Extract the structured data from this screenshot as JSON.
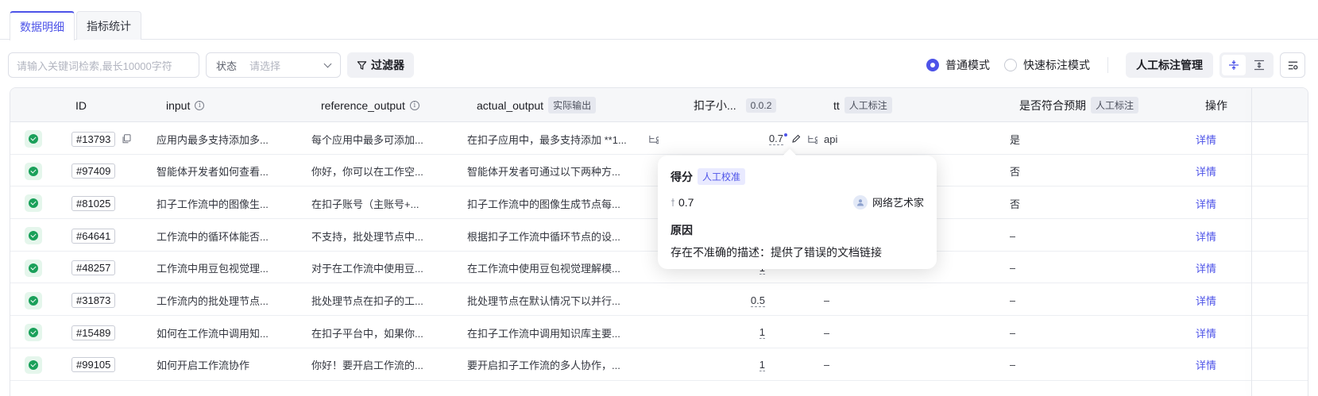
{
  "tabs": [
    {
      "label": "数据明细",
      "active": true
    },
    {
      "label": "指标统计",
      "active": false
    }
  ],
  "toolbar": {
    "search_placeholder": "请输入关键词检索,最长10000字符",
    "status_label": "状态",
    "status_placeholder": "请选择",
    "filter_label": "过滤器",
    "mode_normal": "普通模式",
    "mode_fast": "快速标注模式",
    "manage_label": "人工标注管理"
  },
  "columns": {
    "id": "ID",
    "input": "input",
    "reference_output": "reference_output",
    "actual_output": "actual_output",
    "actual_output_tag": "实际输出",
    "kouzi": "扣子小...",
    "kouzi_version": "0.0.2",
    "tt": "tt",
    "tt_tag": "人工标注",
    "expect": "是否符合预期",
    "expect_tag": "人工标注",
    "op": "操作"
  },
  "rows": [
    {
      "id": "#13793",
      "input": "应用内最多支持添加多...",
      "ref": "每个应用中最多可添加...",
      "actual": "在扣子应用中，最多支持添加 **1...",
      "score": "0.7",
      "tt": "api",
      "expect": "是",
      "op": "详情"
    },
    {
      "id": "#97409",
      "input": "智能体开发者如何查看...",
      "ref": "你好，你可以在工作空...",
      "actual": "智能体开发者可通过以下两种方...",
      "score": "",
      "tt": "",
      "expect": "否",
      "op": "详情"
    },
    {
      "id": "#81025",
      "input": "扣子工作流中的图像生...",
      "ref": "在扣子账号（主账号+...",
      "actual": "扣子工作流中的图像生成节点每...",
      "score": "",
      "tt": "",
      "expect": "否",
      "op": "详情"
    },
    {
      "id": "#64641",
      "input": "工作流中的循环体能否...",
      "ref": "不支持，批处理节点中...",
      "actual": "根据扣子工作流中循环节点的设...",
      "score": "",
      "tt": "",
      "expect": "–",
      "op": "详情"
    },
    {
      "id": "#48257",
      "input": "工作流中用豆包视觉理...",
      "ref": "对于在工作流中使用豆...",
      "actual": "在工作流中使用豆包视觉理解模...",
      "score": "1",
      "tt": "–",
      "expect": "–",
      "op": "详情"
    },
    {
      "id": "#31873",
      "input": "工作流内的批处理节点...",
      "ref": "批处理节点在扣子的工...",
      "actual": "批处理节点在默认情况下以并行...",
      "score": "0.5",
      "tt": "–",
      "expect": "–",
      "op": "详情"
    },
    {
      "id": "#15489",
      "input": "如何在工作流中调用知...",
      "ref": "在扣子平台中，如果你...",
      "actual": "在扣子工作流中调用知识库主要...",
      "score": "1",
      "tt": "–",
      "expect": "–",
      "op": "详情"
    },
    {
      "id": "#99105",
      "input": "如何开启工作流协作",
      "ref": "你好！要开启工作流的...",
      "actual": "要开启扣子工作流的多人协作，...",
      "score": "1",
      "tt": "–",
      "expect": "–",
      "op": "详情"
    }
  ],
  "popover": {
    "title": "得分",
    "tag": "人工校准",
    "score": "0.7",
    "user": "网络艺术家",
    "reason_title": "原因",
    "reason": "存在不准确的描述：提供了错误的文档链接"
  },
  "colors": {
    "accent": "#4d53e8",
    "success": "#1aa05a"
  }
}
